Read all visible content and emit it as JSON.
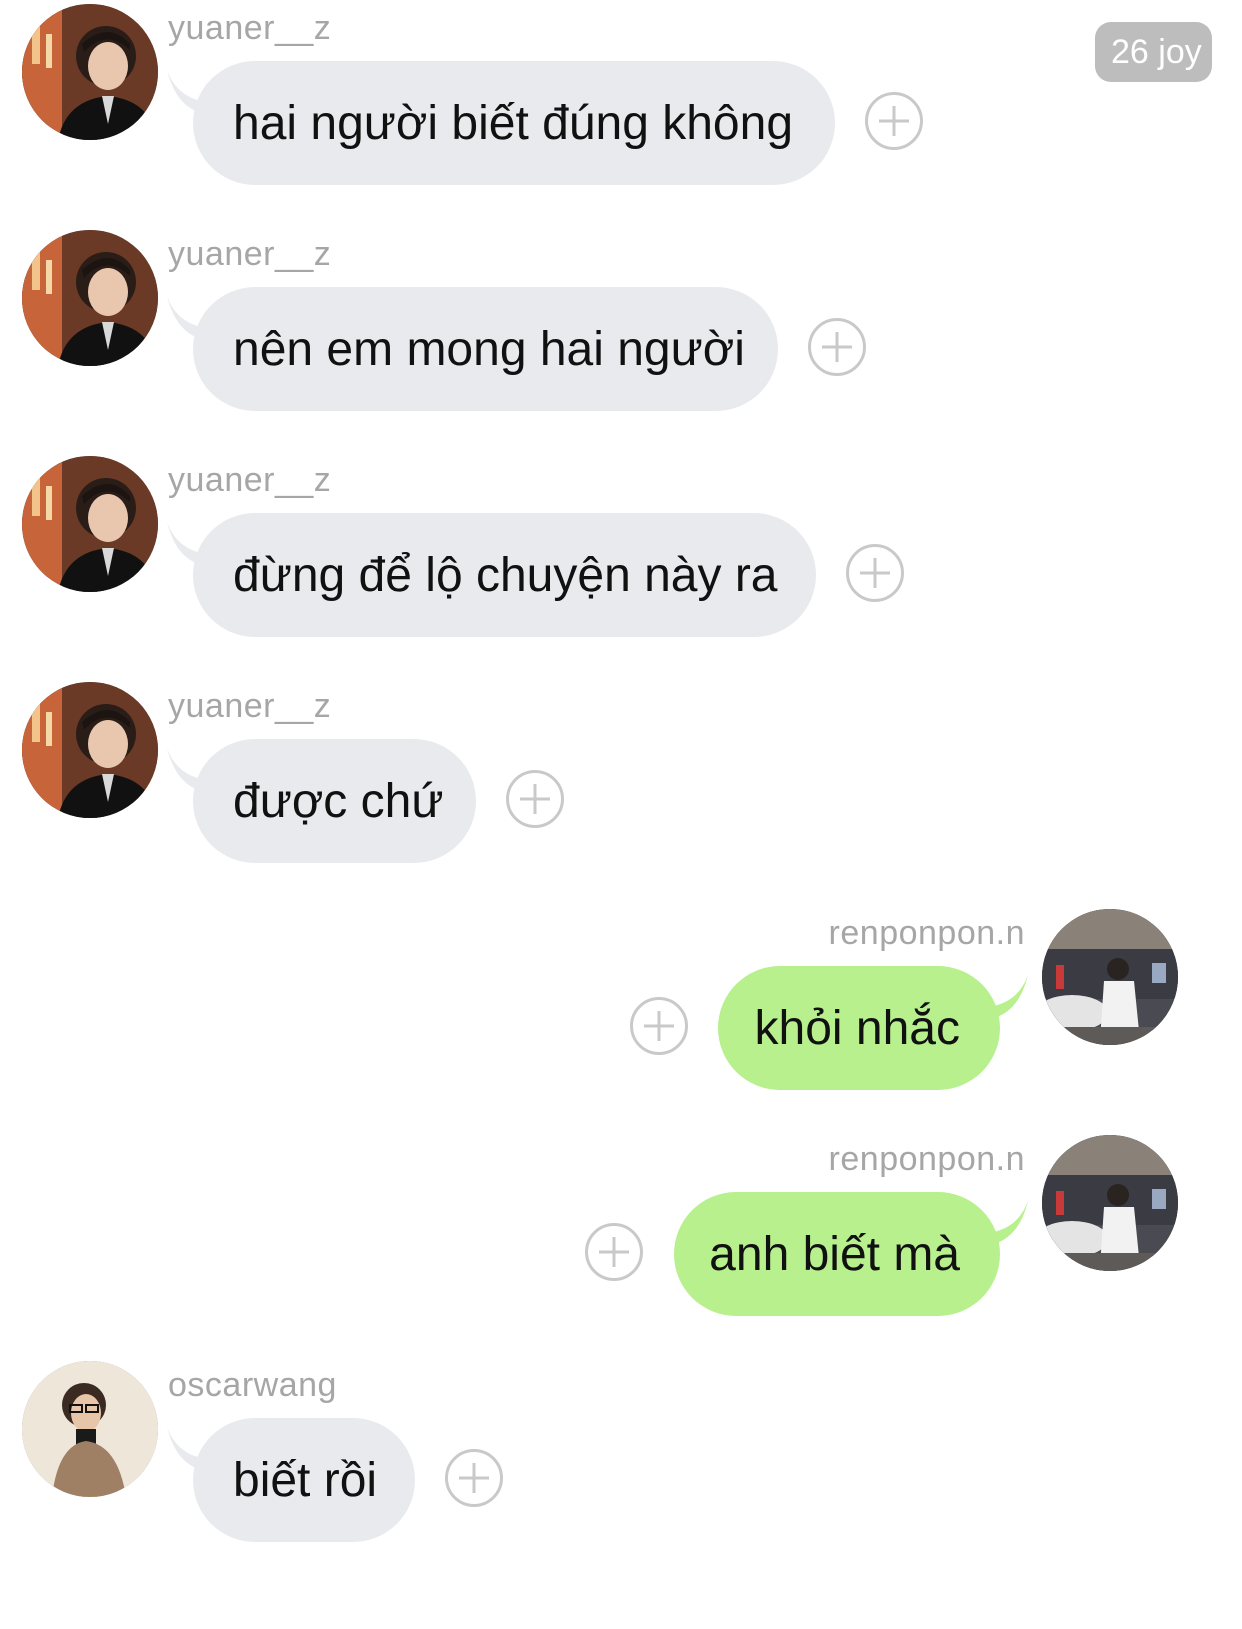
{
  "timestamp_badge": "26 joy",
  "colors": {
    "incoming_bubble": "#e8eaee",
    "outgoing_bubble": "#b7f08d",
    "username": "#a6a6a6",
    "react_icon": "#c9c9c9"
  },
  "messages": [
    {
      "sender": "yuaner__z",
      "direction": "incoming",
      "text": "hai người biết đúng không"
    },
    {
      "sender": "yuaner__z",
      "direction": "incoming",
      "text": "nên em mong hai người"
    },
    {
      "sender": "yuaner__z",
      "direction": "incoming",
      "text": "đừng để lộ chuyện này ra"
    },
    {
      "sender": "yuaner__z",
      "direction": "incoming",
      "text": "được chứ"
    },
    {
      "sender": "renponpon.n",
      "direction": "outgoing",
      "text": "khỏi nhắc"
    },
    {
      "sender": "renponpon.n",
      "direction": "outgoing",
      "text": "anh biết mà"
    },
    {
      "sender": "oscarwang",
      "direction": "incoming",
      "text": "biết rồi"
    }
  ],
  "icons": {
    "react_button": "add-reaction-icon",
    "avatar": "avatar"
  }
}
